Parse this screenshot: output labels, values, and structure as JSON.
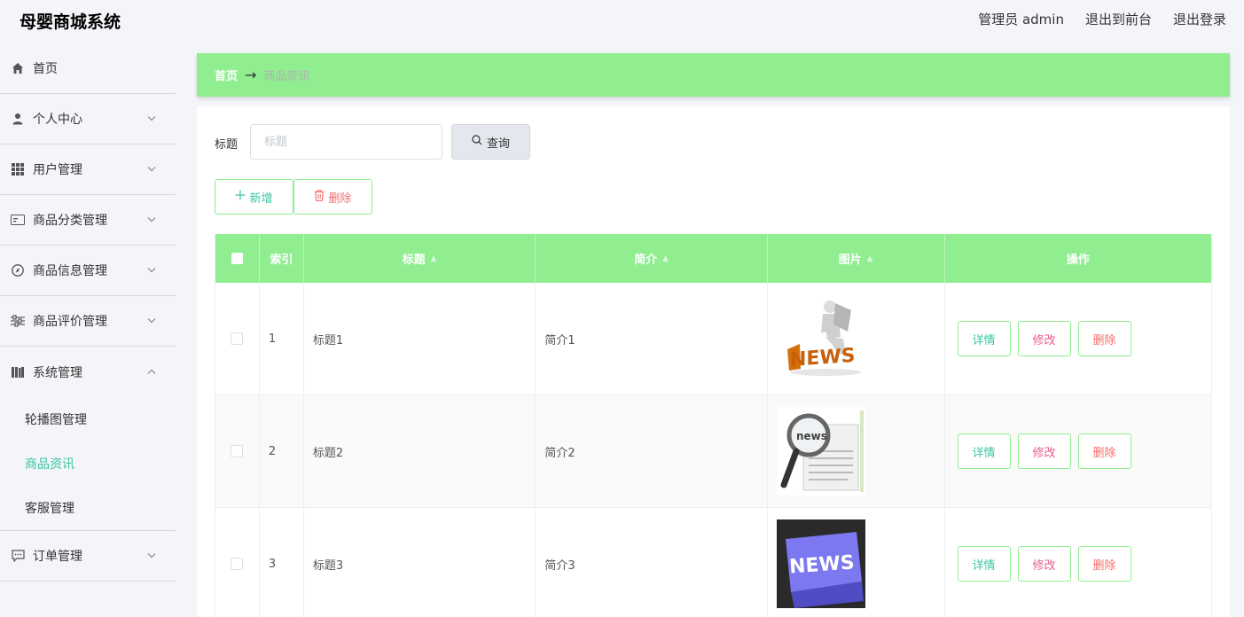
{
  "app": {
    "title": "母婴商城系统",
    "admin_label": "管理员 admin",
    "to_front": "退出到前台",
    "logout": "退出登录"
  },
  "sidebar": {
    "items": [
      {
        "label": "首页",
        "icon": "home-icon"
      },
      {
        "label": "个人中心",
        "icon": "user-icon"
      },
      {
        "label": "用户管理",
        "icon": "grid-icon"
      },
      {
        "label": "商品分类管理",
        "icon": "card-icon"
      },
      {
        "label": "商品信息管理",
        "icon": "compass-icon"
      },
      {
        "label": "商品评价管理",
        "icon": "sliders-icon"
      },
      {
        "label": "系统管理",
        "icon": "books-icon"
      },
      {
        "label": "订单管理",
        "icon": "chat-icon"
      }
    ],
    "sub_items": [
      {
        "label": "轮播图管理"
      },
      {
        "label": "商品资讯",
        "active": true
      },
      {
        "label": "客服管理"
      }
    ]
  },
  "breadcrumb": {
    "home": "首页",
    "separator": "→",
    "current": "商品资讯"
  },
  "search": {
    "label": "标题",
    "placeholder": "标题",
    "value": "",
    "button": "查询"
  },
  "actions": {
    "add": "新增",
    "delete": "删除"
  },
  "table": {
    "headers": {
      "index": "索引",
      "title": "标题",
      "intro": "简介",
      "image": "图片",
      "ops": "操作"
    },
    "op_labels": {
      "detail": "详情",
      "edit": "修改",
      "delete": "删除"
    },
    "rows": [
      {
        "index": "1",
        "title": "标题1",
        "intro": "简介1",
        "image": "news-man-image"
      },
      {
        "index": "2",
        "title": "标题2",
        "intro": "简介2",
        "image": "news-magnifier-image"
      },
      {
        "index": "3",
        "title": "标题3",
        "intro": "简介3",
        "image": "news-key-image"
      }
    ]
  },
  "colors": {
    "accent_green": "#90ee90",
    "active_teal": "#3cc4a4",
    "danger": "#f56c6c",
    "edit_pink": "#e65c8a"
  }
}
